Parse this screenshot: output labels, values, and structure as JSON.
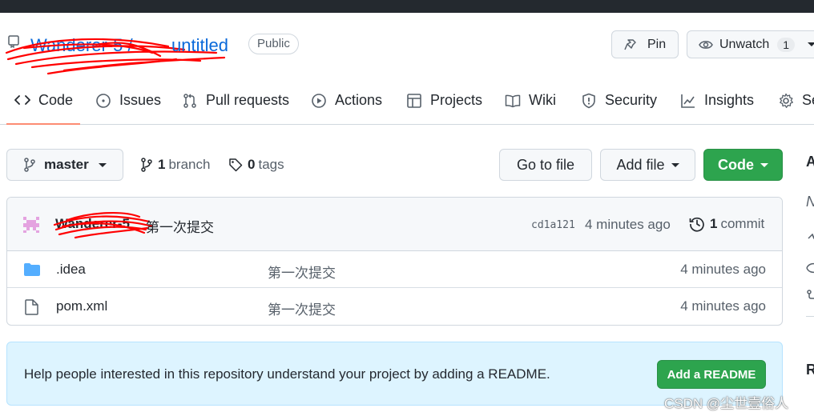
{
  "header": {
    "owner": "Wanderer-5",
    "separator": "/",
    "repo_name": "untitled",
    "visibility": "Public",
    "pin_label": "Pin",
    "watch_label": "Unwatch",
    "watch_count": "1"
  },
  "tabs": [
    {
      "label": "Code",
      "icon": "code-icon"
    },
    {
      "label": "Issues",
      "icon": "issue-icon"
    },
    {
      "label": "Pull requests",
      "icon": "pull-request-icon"
    },
    {
      "label": "Actions",
      "icon": "play-icon"
    },
    {
      "label": "Projects",
      "icon": "table-icon"
    },
    {
      "label": "Wiki",
      "icon": "book-icon"
    },
    {
      "label": "Security",
      "icon": "shield-icon"
    },
    {
      "label": "Insights",
      "icon": "graph-icon"
    },
    {
      "label": "Settings",
      "icon": "gear-icon"
    }
  ],
  "toolbar": {
    "branch": "master",
    "branch_count": "1",
    "branch_label": "branch",
    "tag_count": "0",
    "tag_label": "tags",
    "goto_label": "Go to file",
    "addfile_label": "Add file",
    "code_label": "Code"
  },
  "commit": {
    "author": "Wanderer-5",
    "message": "第一次提交",
    "sha": "cd1a121",
    "time": "4 minutes ago",
    "count": "1",
    "count_label": "commit"
  },
  "files": [
    {
      "name": ".idea",
      "type": "folder",
      "message": "第一次提交",
      "time": "4 minutes ago"
    },
    {
      "name": "pom.xml",
      "type": "file",
      "message": "第一次提交",
      "time": "4 minutes ago"
    }
  ],
  "readme": {
    "text": "Help people interested in this repository understand your project by adding a README.",
    "button": "Add a README"
  },
  "sidebar": {
    "about_fragment": "A",
    "desc_fragment": "N",
    "releases_fragment": "R"
  },
  "watermark": "CSDN @尘世壹俗人",
  "colors": {
    "link": "#0969da",
    "primary_green": "#2da44e",
    "active_tab_underline": "#fd8c73",
    "banner_bg": "#ddf4ff",
    "redaction": "#ff0000",
    "folder": "#54aeff"
  }
}
